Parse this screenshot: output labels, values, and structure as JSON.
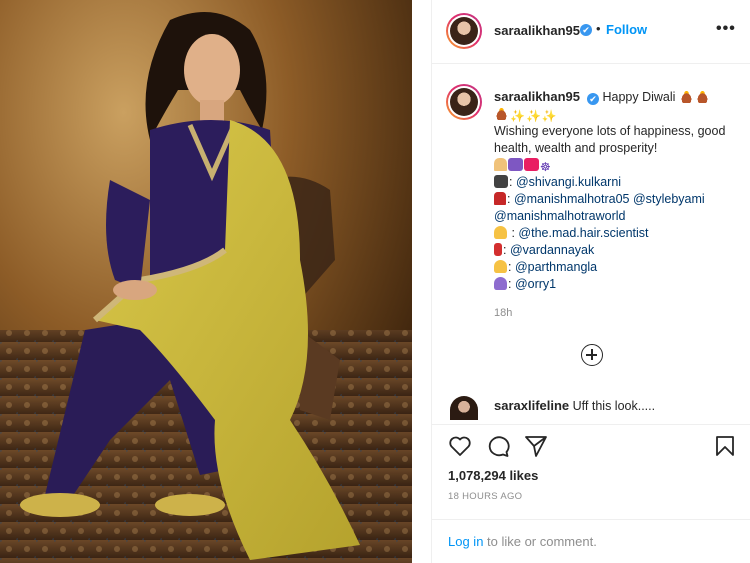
{
  "post": {
    "photo_alt": "",
    "username": "saraalikhan95",
    "verified_mark": "✔",
    "separator": "•",
    "follow_label": "Follow",
    "more_label": "•••"
  },
  "caption": {
    "username": "saraalikhan95",
    "greeting": "Happy Diwali",
    "line_wish": "Wishing everyone lots of happiness, good health, wealth and prosperity!",
    "credits": [
      {
        "icon": "camera-icon",
        "prefix": ": ",
        "mentions": [
          "@shivangi.kulkarni"
        ]
      },
      {
        "icon": "dress-icon",
        "prefix": ": ",
        "mentions": [
          "@manishmalhotra05",
          "@stylebyami",
          "@manishmalhotraworld"
        ]
      },
      {
        "icon": "hairdresser-icon",
        "prefix": " : ",
        "mentions": [
          "@the.mad.hair.scientist"
        ]
      },
      {
        "icon": "lipstick-icon",
        "prefix": ": ",
        "mentions": [
          "@vardannayak"
        ]
      },
      {
        "icon": "person-icon",
        "prefix": ": ",
        "mentions": [
          "@parthmangla"
        ]
      },
      {
        "icon": "purple-person-icon",
        "prefix": ": ",
        "mentions": [
          "@orry1"
        ]
      }
    ],
    "time_ago": "18h"
  },
  "comment": {
    "username": "saraxlifeline",
    "text": "Uff this look....."
  },
  "stats": {
    "likes": "1,078,294 likes",
    "date": "18 HOURS AGO"
  },
  "login": {
    "link": "Log in",
    "rest": "to like or comment."
  },
  "colors": {
    "accent": "#0095f6",
    "mention": "#00376b",
    "muted": "#8e8e8e",
    "verified": "#3897f0"
  }
}
